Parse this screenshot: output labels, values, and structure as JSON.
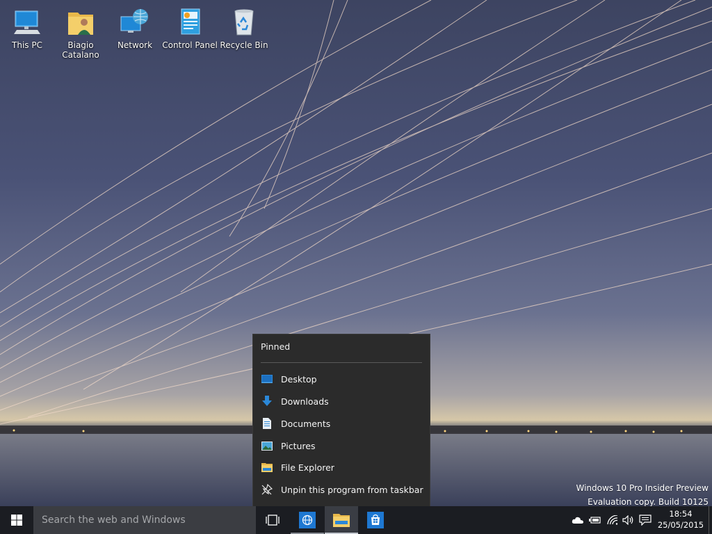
{
  "desktop": {
    "icons": [
      {
        "label": "This PC",
        "icon": "computer-icon"
      },
      {
        "label": "Biagio\nCatalano",
        "icon": "user-folder-icon"
      },
      {
        "label": "Network",
        "icon": "network-icon"
      },
      {
        "label": "Control Panel",
        "icon": "control-panel-icon"
      },
      {
        "label": "Recycle Bin",
        "icon": "recycle-bin-icon"
      }
    ]
  },
  "watermark": {
    "line1": "Windows 10 Pro Insider Preview",
    "line2": "Evaluation copy. Build 10125"
  },
  "jumplist": {
    "section_title": "Pinned",
    "items": [
      {
        "label": "Desktop",
        "icon": "desktop-folder-icon"
      },
      {
        "label": "Downloads",
        "icon": "download-arrow-icon"
      },
      {
        "label": "Documents",
        "icon": "document-icon"
      },
      {
        "label": "Pictures",
        "icon": "pictures-icon"
      },
      {
        "label": "File Explorer",
        "icon": "file-explorer-icon"
      },
      {
        "label": "Unpin this program from taskbar",
        "icon": "unpin-icon"
      }
    ]
  },
  "taskbar": {
    "search_placeholder": "Search the web and Windows",
    "buttons": [
      {
        "name": "task-view",
        "icon": "task-view-icon"
      },
      {
        "name": "internet-explorer",
        "icon": "globe-icon"
      },
      {
        "name": "file-explorer",
        "icon": "folder-icon"
      },
      {
        "name": "store",
        "icon": "store-icon"
      }
    ],
    "tray": [
      "onedrive-icon",
      "battery-icon",
      "wifi-icon",
      "volume-icon",
      "action-center-icon"
    ],
    "clock": {
      "time": "18:54",
      "date": "25/05/2015"
    }
  },
  "colors": {
    "taskbar": "#1b1d22",
    "search_box": "#3b3d42",
    "jumplist_bg": "#2b2b2b",
    "accent_blue": "#2b88d8",
    "store_blue": "#1e78d2",
    "folder_yellow": "#f2c75c"
  }
}
